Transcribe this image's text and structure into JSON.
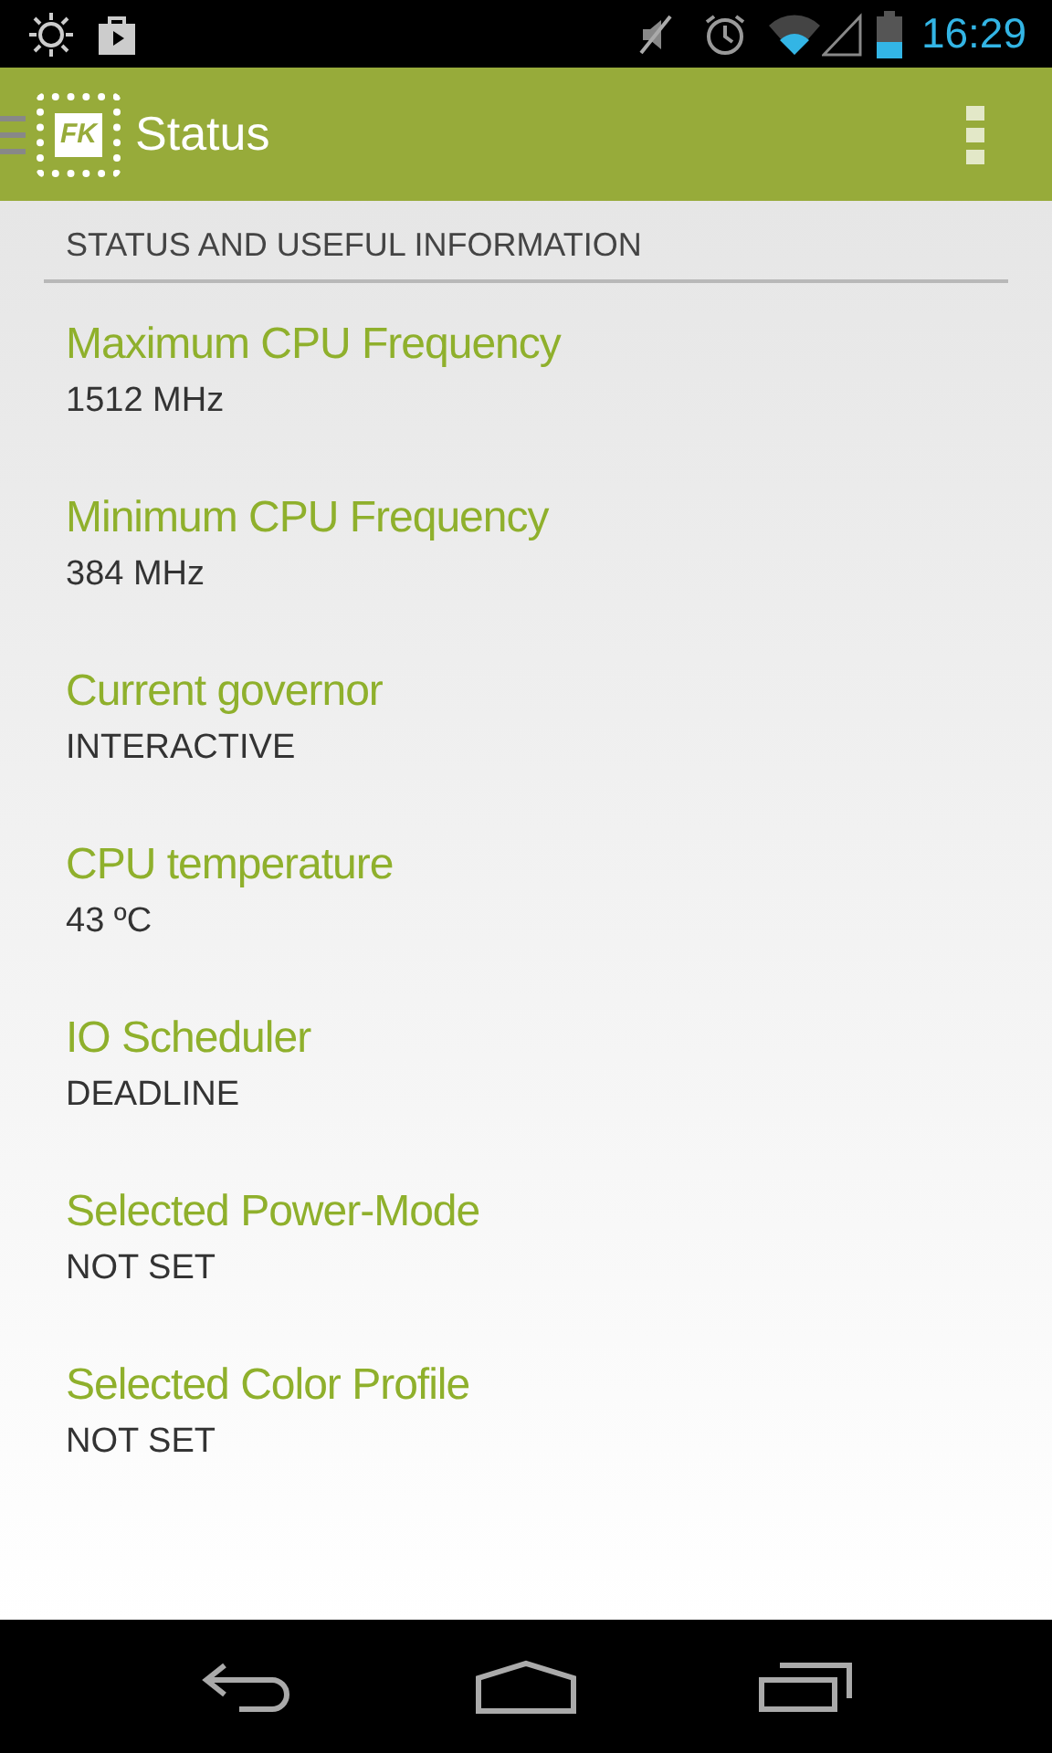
{
  "status_bar": {
    "time": "16:29"
  },
  "app_bar": {
    "logo_text": "FK",
    "title": "Status"
  },
  "section": {
    "header": "STATUS AND USEFUL INFORMATION"
  },
  "items": [
    {
      "title": "Maximum CPU Frequency",
      "value": "1512 MHz"
    },
    {
      "title": "Minimum CPU Frequency",
      "value": "384 MHz"
    },
    {
      "title": "Current governor",
      "value": "INTERACTIVE"
    },
    {
      "title": "CPU temperature",
      "value": "43 ºC"
    },
    {
      "title": "IO Scheduler",
      "value": "DEADLINE"
    },
    {
      "title": "Selected Power-Mode",
      "value": "NOT SET"
    },
    {
      "title": "Selected Color Profile",
      "value": "NOT SET"
    }
  ]
}
